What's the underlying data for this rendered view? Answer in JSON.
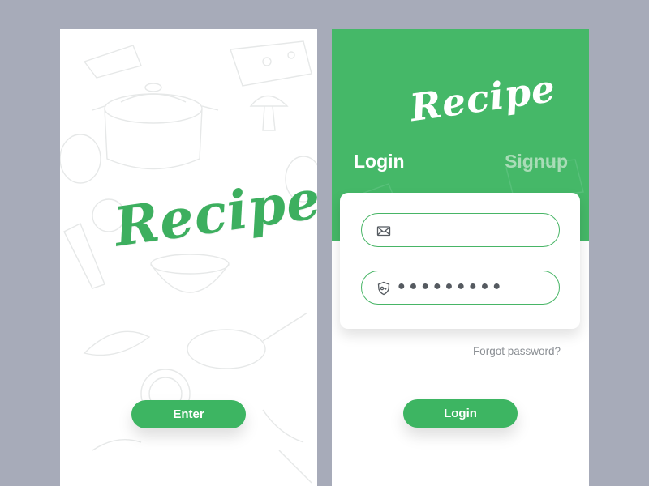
{
  "splash": {
    "logo_text": "Recipe",
    "enter_label": "Enter"
  },
  "login": {
    "logo_text": "Recipe",
    "tabs": {
      "login": "Login",
      "signup": "Signup"
    },
    "email": {
      "value": "",
      "icon": "envelope-icon"
    },
    "password": {
      "value_masked": "●●●●●●●●●",
      "icon": "lock-icon"
    },
    "forgot_password_label": "Forgot password?",
    "login_button_label": "Login"
  },
  "colors": {
    "background": "#a7abb9",
    "brand_green": "#3db562",
    "header_green": "#45b868",
    "inactive_tab": "#a9dcb7",
    "muted_text": "#8b8f94"
  }
}
